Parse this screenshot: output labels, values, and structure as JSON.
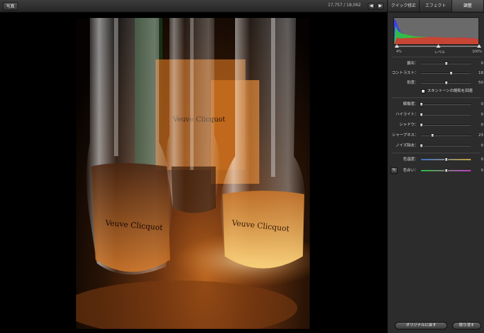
{
  "toolbar": {
    "photos_label": "写真",
    "counter": "17,757 / 18,062",
    "prev_icon": "arrow-left-icon",
    "next_icon": "arrow-right-icon"
  },
  "photo": {
    "label_left": "Veuve Clicquot",
    "label_right": "Veuve Clicquot",
    "label_mid": "Veuve Clicquot"
  },
  "panel": {
    "tabs": [
      {
        "label": "クイック修正",
        "active": false
      },
      {
        "label": "エフェクト",
        "active": false
      },
      {
        "label": "調整",
        "active": true
      }
    ],
    "levels": {
      "label": "レベル",
      "min": "4%",
      "max": "100%"
    },
    "sliders_group1": [
      {
        "label": "露出：",
        "value": "0",
        "pos": 0.5
      },
      {
        "label": "コントラスト：",
        "value": "18",
        "pos": 0.6
      },
      {
        "label": "彩度：",
        "value": "50",
        "pos": 0.5
      }
    ],
    "skin_checkbox": "スキントーンの飽和を回避",
    "sliders_group2": [
      {
        "label": "解像度：",
        "value": "0",
        "pos": 0.0
      },
      {
        "label": "ハイライト：",
        "value": "0",
        "pos": 0.0
      },
      {
        "label": "シャドウ：",
        "value": "0",
        "pos": 0.0
      },
      {
        "label": "シャープネス：",
        "value": "23",
        "pos": 0.23
      },
      {
        "label": "ノイズ除去：",
        "value": "0",
        "pos": 0.0
      }
    ],
    "sliders_group3": [
      {
        "label": "色温度：",
        "value": "0",
        "pos": 0.5
      },
      {
        "label": "色合い：",
        "value": "0",
        "pos": 0.5
      }
    ],
    "buttons": {
      "revert": "オリジナルに戻す",
      "undo": "取り消す"
    }
  },
  "colors": {
    "panel_bg": "#2c2c2c",
    "highlight_amber": "#e08a2a"
  }
}
